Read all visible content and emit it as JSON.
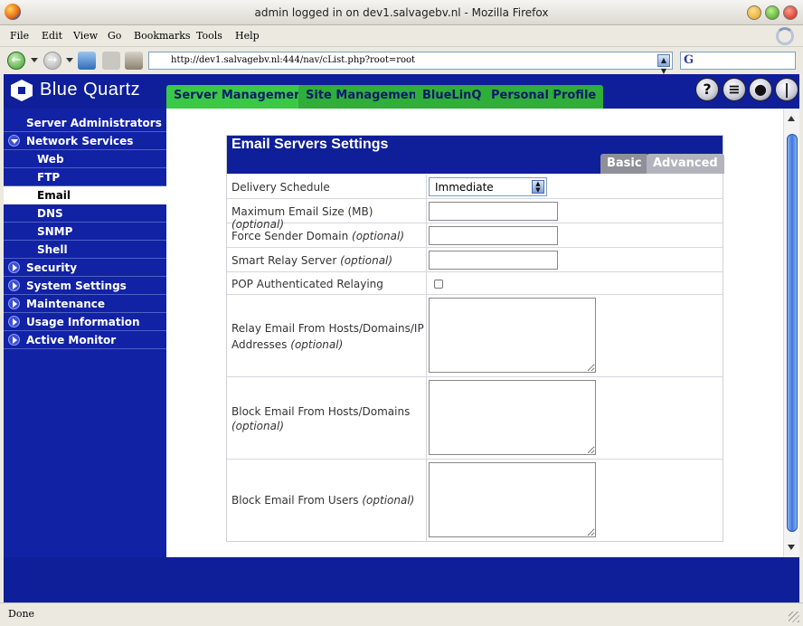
{
  "window": {
    "title": "admin logged in on dev1.salvagebv.nl - Mozilla Firefox"
  },
  "menu": [
    "File",
    "Edit",
    "View",
    "Go",
    "Bookmarks",
    "Tools",
    "Help"
  ],
  "address": {
    "url": "http://dev1.salvagebv.nl:444/nav/cList.php?root=root"
  },
  "app": {
    "brand": "Blue Quartz",
    "tabs": [
      "Server Management",
      "Site Management",
      "BlueLinQ",
      "Personal Profile"
    ],
    "active_tab": "Server Management",
    "header_icons": [
      "help-icon",
      "update-icon",
      "view-icon",
      "logout-icon"
    ]
  },
  "sidebar": {
    "items": [
      {
        "label": "Server Administrators",
        "level": 0,
        "icon": "none"
      },
      {
        "label": "Network Services",
        "level": 0,
        "icon": "expanded"
      },
      {
        "label": "Web",
        "level": 1
      },
      {
        "label": "FTP",
        "level": 1
      },
      {
        "label": "Email",
        "level": 1,
        "active": true
      },
      {
        "label": "DNS",
        "level": 1
      },
      {
        "label": "SNMP",
        "level": 1
      },
      {
        "label": "Shell",
        "level": 1
      },
      {
        "label": "Security",
        "level": 0,
        "icon": "collapsed"
      },
      {
        "label": "System Settings",
        "level": 0,
        "icon": "collapsed"
      },
      {
        "label": "Maintenance",
        "level": 0,
        "icon": "collapsed"
      },
      {
        "label": "Usage Information",
        "level": 0,
        "icon": "collapsed"
      },
      {
        "label": "Active Monitor",
        "level": 0,
        "icon": "collapsed"
      }
    ]
  },
  "panel": {
    "title": "Email Servers Settings",
    "tabs": {
      "basic": "Basic",
      "advanced": "Advanced"
    },
    "optional": "(optional)",
    "fields": {
      "delivery_schedule": {
        "label": "Delivery Schedule",
        "value": "Immediate"
      },
      "max_size": {
        "label": "Maximum Email Size (MB)"
      },
      "force_sender": {
        "label": "Force Sender Domain"
      },
      "smart_relay": {
        "label": "Smart Relay Server"
      },
      "pop_relay": {
        "label": "POP Authenticated Relaying",
        "checked": false
      },
      "relay_from": {
        "label": "Relay Email From Hosts/Domains/IP Addresses"
      },
      "block_hosts": {
        "label": "Block Email From Hosts/Domains"
      },
      "block_users": {
        "label": "Block Email From Users"
      }
    }
  },
  "status": {
    "text": "Done"
  },
  "colors": {
    "header_blue": "#0f1f99",
    "tab_green": "#2fae3a",
    "subtab_gray": "#8f8f99"
  }
}
